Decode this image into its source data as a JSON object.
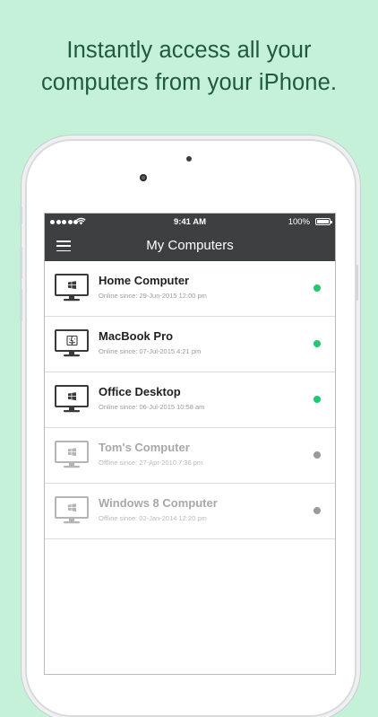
{
  "headline": {
    "line1": "Instantly access all your",
    "line2": "computers from your iPhone."
  },
  "status_bar": {
    "time": "9:41 AM",
    "battery": "100%"
  },
  "nav": {
    "title": "My Computers"
  },
  "colors": {
    "online": "#23c770",
    "offline": "#9a9a9a",
    "background": "#c4f1d8",
    "navbar": "#3e3f41"
  },
  "computers": [
    {
      "name": "Home Computer",
      "since": "Online since: 29-Jun-2015 12:00 pm",
      "os": "windows",
      "status": "online"
    },
    {
      "name": "MacBook Pro",
      "since": "Online since: 07-Jul-2015 4:21 pm",
      "os": "mac",
      "status": "online"
    },
    {
      "name": "Office Desktop",
      "since": "Online since: 06-Jul-2015 10:58 am",
      "os": "windows",
      "status": "online"
    },
    {
      "name": "Tom's Computer",
      "since": "Offline since: 27-Apr-2010 7:36 pm",
      "os": "windows",
      "status": "offline"
    },
    {
      "name": "Windows 8 Computer",
      "since": "Offline since: 02-Jan-2014 12:20 pm",
      "os": "windows",
      "status": "offline"
    }
  ]
}
